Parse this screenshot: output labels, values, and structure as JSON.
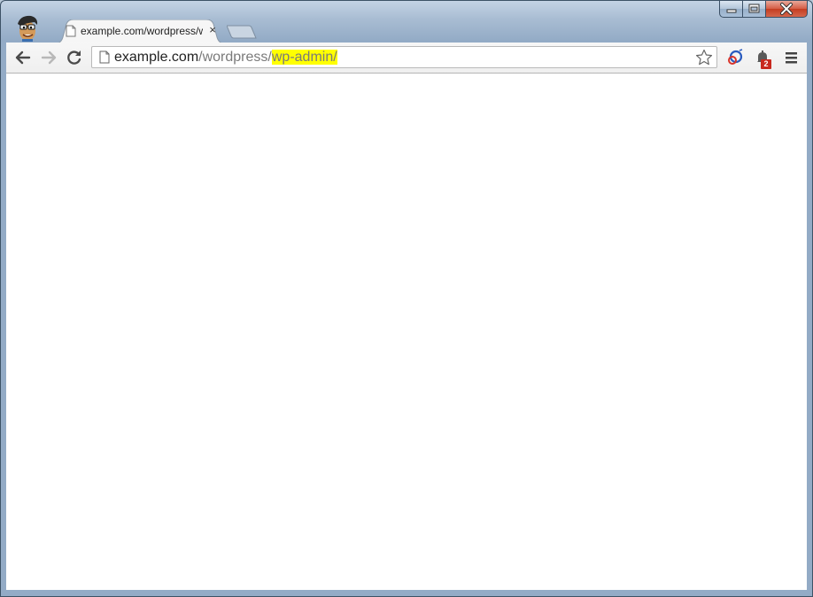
{
  "tab": {
    "title": "example.com/wordpress/wp-admin/",
    "close_glyph": "×"
  },
  "omnibox": {
    "url_host": "example.com",
    "url_path": "/wordpress/",
    "url_highlight": "wp-admin/"
  },
  "notifications": {
    "count": "2"
  },
  "colors": {
    "highlight": "#ffff00",
    "badge": "#c8281e"
  },
  "icons": {
    "back": "back-arrow-icon",
    "forward": "forward-arrow-icon",
    "reload": "reload-icon",
    "page": "page-icon",
    "bookmark": "star-icon",
    "extension": "extension-icon",
    "notifications": "bell-icon",
    "menu": "hamburger-menu-icon"
  }
}
